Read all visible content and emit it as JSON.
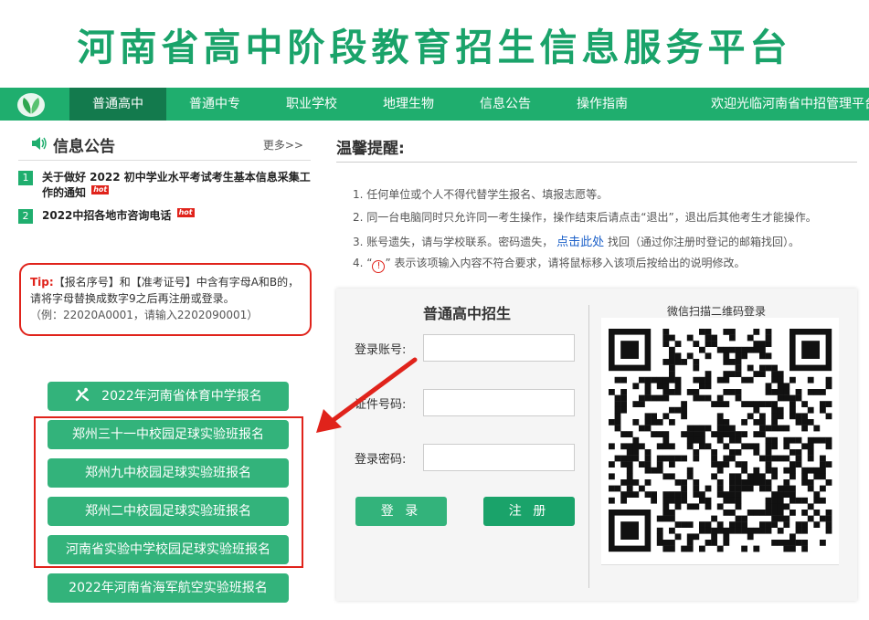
{
  "site": {
    "title": "河南省高中阶段教育招生信息服务平台"
  },
  "colors": {
    "brand_green": "#1fae6e",
    "nav_active": "#137a4d",
    "button_green": "#33b37b",
    "alert_red": "#e0231b",
    "link_blue": "#1a5fc8"
  },
  "nav": {
    "logo_icon": "leaf-logo-icon",
    "items": [
      {
        "label": "普通高中",
        "active": true
      },
      {
        "label": "普通中专",
        "active": false
      },
      {
        "label": "职业学校",
        "active": false
      },
      {
        "label": "地理生物",
        "active": false
      },
      {
        "label": "信息公告",
        "active": false
      },
      {
        "label": "操作指南",
        "active": false
      }
    ],
    "welcome": "欢迎光临河南省中招管理平台"
  },
  "notice": {
    "title": "信息公告",
    "icon": "speaker-icon",
    "more": "更多>>",
    "items": [
      {
        "num": "1",
        "text": "关于做好 2022 初中学业水平考试考生基本信息采集工作的通知",
        "hot": "hot"
      },
      {
        "num": "2",
        "text": "2022中招各地市咨询电话",
        "hot": "hot"
      }
    ]
  },
  "tip": {
    "label": "Tip:",
    "text": "【报名序号】和【准考证号】中含有字母A和B的，请将字母替换成数字9之后再注册或登录。",
    "example": "（例：22020A0001，请输入2202090001）"
  },
  "buttons": {
    "sports": "2022年河南省体育中学报名",
    "zz31": "郑州三十一中校园足球实验班报名",
    "zz9": "郑州九中校园足球实验班报名",
    "zz2": "郑州二中校园足球实验班报名",
    "hnsy": "河南省实验中学校园足球实验班报名",
    "navy": "2022年河南省海军航空实验班报名"
  },
  "warm": {
    "title": "温馨提醒:",
    "line1": "1. 任何单位或个人不得代替学生报名、填报志愿等。",
    "line2": "2. 同一台电脑同时只允许同一考生操作，操作结束后请点击“退出”，退出后其他考生才能操作。",
    "line3_a": "3. 账号遗失，请与学校联系。密码遗失，",
    "line3_link": "点击此处",
    "line3_b": "找回（通过你注册时登记的邮箱找回）。",
    "line4_a": "4. “",
    "line4_icon": "!",
    "line4_b": "” 表示该项输入内容不符合要求，请将鼠标移入该项后按给出的说明修改。"
  },
  "login": {
    "title": "普通高中招生",
    "account_label": "登录账号:",
    "account_value": "",
    "id_label": "证件号码:",
    "id_value": "",
    "password_label": "登录密码:",
    "password_value": "",
    "login_btn": "登 录",
    "register_btn": "注 册",
    "qr_title": "微信扫描二维码登录"
  }
}
